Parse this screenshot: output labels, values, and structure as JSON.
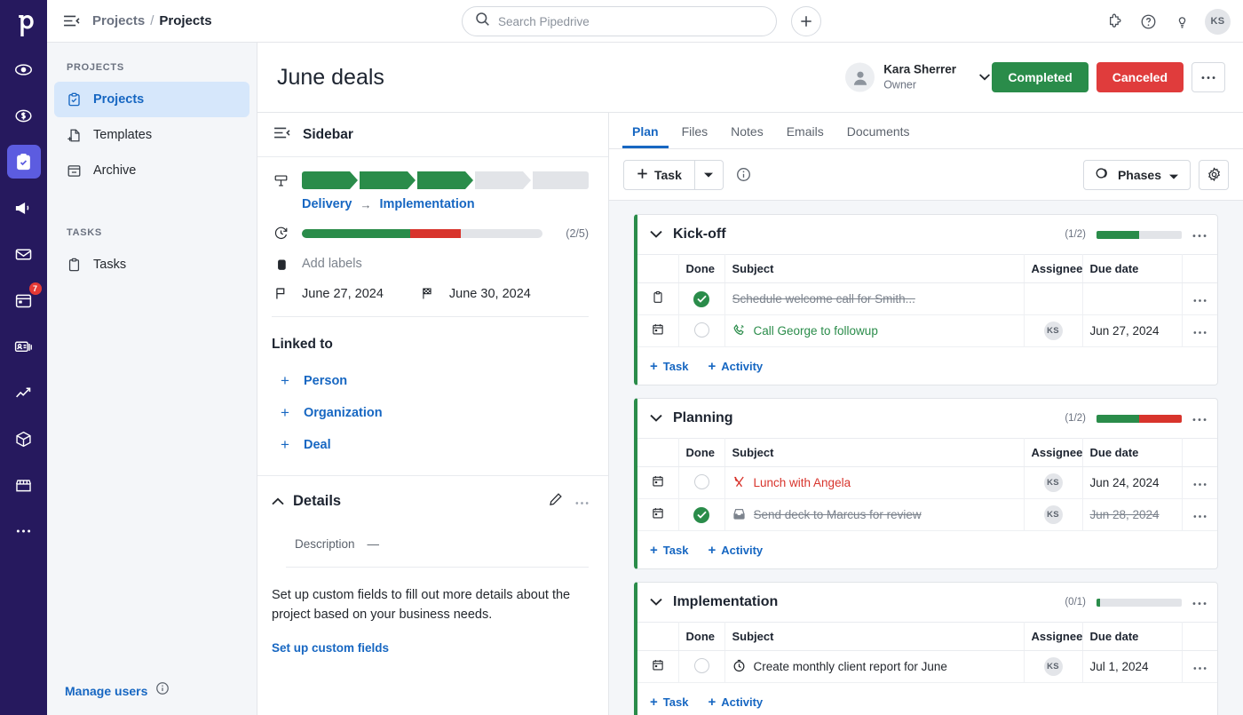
{
  "rail": {
    "logo": "pipedrive-logo",
    "items": [
      {
        "name": "leads-icon",
        "badge": null
      },
      {
        "name": "deals-icon",
        "badge": null
      },
      {
        "name": "projects-icon",
        "badge": null,
        "active": true
      },
      {
        "name": "campaigns-icon",
        "badge": null
      },
      {
        "name": "mail-icon",
        "badge": null
      },
      {
        "name": "calendar-icon",
        "badge": "7"
      },
      {
        "name": "contacts-icon",
        "badge": null
      },
      {
        "name": "insights-icon",
        "badge": null
      },
      {
        "name": "products-icon",
        "badge": null
      },
      {
        "name": "marketplace-icon",
        "badge": null
      },
      {
        "name": "more-icon",
        "badge": null
      }
    ]
  },
  "topbar": {
    "breadcrumb_parent": "Projects",
    "breadcrumb_sep": "/",
    "breadcrumb_current": "Projects",
    "search_placeholder": "Search Pipedrive",
    "search_value": ""
  },
  "nav": {
    "section_projects": "PROJECTS",
    "section_tasks": "TASKS",
    "projects_items": [
      {
        "label": "Projects",
        "icon": "clipboard-check-icon",
        "active": true
      },
      {
        "label": "Templates",
        "icon": "file-plus-icon",
        "active": false
      },
      {
        "label": "Archive",
        "icon": "archive-icon",
        "active": false
      }
    ],
    "tasks_items": [
      {
        "label": "Tasks",
        "icon": "clipboard-icon",
        "active": false
      }
    ],
    "manage_users": "Manage users"
  },
  "header": {
    "project_title": "June deals",
    "owner_name": "Kara Sherrer",
    "owner_role": "Owner",
    "owner_initials": "KS",
    "completed_label": "Completed",
    "canceled_label": "Canceled",
    "more_label": "…",
    "accent_green": "#2a8c4a",
    "accent_red": "#e03c3c"
  },
  "sidebar": {
    "title": "Sidebar",
    "stage_chevrons": [
      true,
      true,
      true,
      false,
      false
    ],
    "stage_from": "Delivery",
    "stage_to": "Implementation",
    "stage_arrow": "→",
    "task_progress": {
      "green_pct": 45,
      "red_pct": 21,
      "count": "(2/5)"
    },
    "add_labels": "Add labels",
    "start_date": "June 27, 2024",
    "end_date": "June 30, 2024",
    "linked_title": "Linked to",
    "linked_items": [
      {
        "label": "Person",
        "icon": "plus-icon"
      },
      {
        "label": "Organization",
        "icon": "plus-icon"
      },
      {
        "label": "Deal",
        "icon": "plus-icon"
      }
    ],
    "details_title": "Details",
    "description_label": "Description",
    "description_value": "—",
    "custom_fields_text": "Set up custom fields to fill out more details about the project based on your business needs.",
    "custom_fields_link": "Set up custom fields"
  },
  "main": {
    "tabs": [
      {
        "label": "Plan",
        "active": true
      },
      {
        "label": "Files",
        "active": false
      },
      {
        "label": "Notes",
        "active": false
      },
      {
        "label": "Emails",
        "active": false
      },
      {
        "label": "Documents",
        "active": false
      }
    ],
    "task_button": "Task",
    "phases_button": "Phases",
    "columns": [
      "Done",
      "Subject",
      "Assignee",
      "Due date"
    ],
    "add_task_label": "Task",
    "add_activity_label": "Activity",
    "phases": [
      {
        "name": "Kick-off",
        "count": "(1/2)",
        "bar": {
          "green_pct": 50,
          "red_pct": 0
        },
        "rows": [
          {
            "type_icon": "clipboard-icon",
            "done": true,
            "subject": "Schedule welcome call for Smith...",
            "subject_icon": null,
            "subject_color": "grey",
            "assignee": "",
            "due": "",
            "due_color": "grey"
          },
          {
            "type_icon": "calendar-icon",
            "done": false,
            "subject": "Call George to followup",
            "subject_icon": "phone-icon",
            "subject_color": "green",
            "assignee": "KS",
            "due": "Jun 27, 2024",
            "due_color": "green"
          }
        ]
      },
      {
        "name": "Planning",
        "count": "(1/2)",
        "bar": {
          "green_pct": 50,
          "red_pct": 50
        },
        "rows": [
          {
            "type_icon": "calendar-icon",
            "done": false,
            "subject": "Lunch with Angela",
            "subject_icon": "lunch-icon",
            "subject_color": "red",
            "assignee": "KS",
            "due": "Jun 24, 2024",
            "due_color": "red"
          },
          {
            "type_icon": "calendar-icon",
            "done": true,
            "subject": "Send deck to Marcus for review",
            "subject_icon": "inbox-icon",
            "subject_color": "grey",
            "assignee": "KS",
            "due": "Jun 28, 2024",
            "due_color": "grey"
          }
        ]
      },
      {
        "name": "Implementation",
        "count": "(0/1)",
        "bar": {
          "green_pct": 4,
          "red_pct": 0
        },
        "rows": [
          {
            "type_icon": "calendar-icon",
            "done": false,
            "subject": "Create monthly client report for June",
            "subject_icon": "clock-icon",
            "subject_color": "dark",
            "assignee": "KS",
            "due": "Jul 1, 2024",
            "due_color": "dark"
          }
        ]
      }
    ]
  }
}
